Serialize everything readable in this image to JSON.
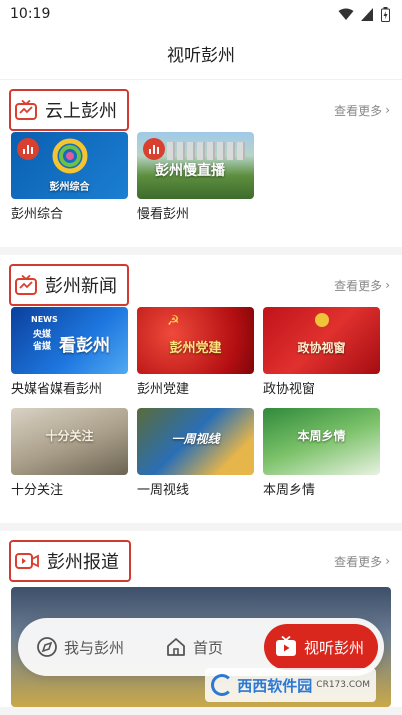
{
  "status": {
    "time": "10:19"
  },
  "header": {
    "title": "视听彭州"
  },
  "sections": [
    {
      "title": "云上彭州",
      "more": "查看更多",
      "items": [
        {
          "label": "彭州综合",
          "overlay": "彭州综合"
        },
        {
          "label": "慢看彭州",
          "overlay": "彭州慢直播"
        }
      ]
    },
    {
      "title": "彭州新闻",
      "more": "查看更多",
      "items": [
        {
          "label": "央媒省媒看彭州",
          "overlay": "看彭州",
          "overlay_small_1": "NEWS",
          "overlay_small_2": "央媒",
          "overlay_small_3": "省媒"
        },
        {
          "label": "彭州党建",
          "overlay": "彭州党建"
        },
        {
          "label": "政协视窗",
          "overlay": "政协视窗"
        },
        {
          "label": "十分关注",
          "overlay": "十分关注"
        },
        {
          "label": "一周视线",
          "overlay": "一周视线"
        },
        {
          "label": "本周乡情",
          "overlay": "本周乡情"
        }
      ]
    },
    {
      "title": "彭州报道",
      "more": "查看更多",
      "items": []
    }
  ],
  "bottom_nav": {
    "items": [
      {
        "label": "我与彭州"
      },
      {
        "label": "首页"
      },
      {
        "label": "视听彭州"
      }
    ]
  },
  "watermark": {
    "text": "西西软件园",
    "sub": "CR173.COM"
  },
  "colors": {
    "accent": "#d9271e",
    "title_border": "#d33a2f",
    "watermark": "#2c78d4"
  }
}
